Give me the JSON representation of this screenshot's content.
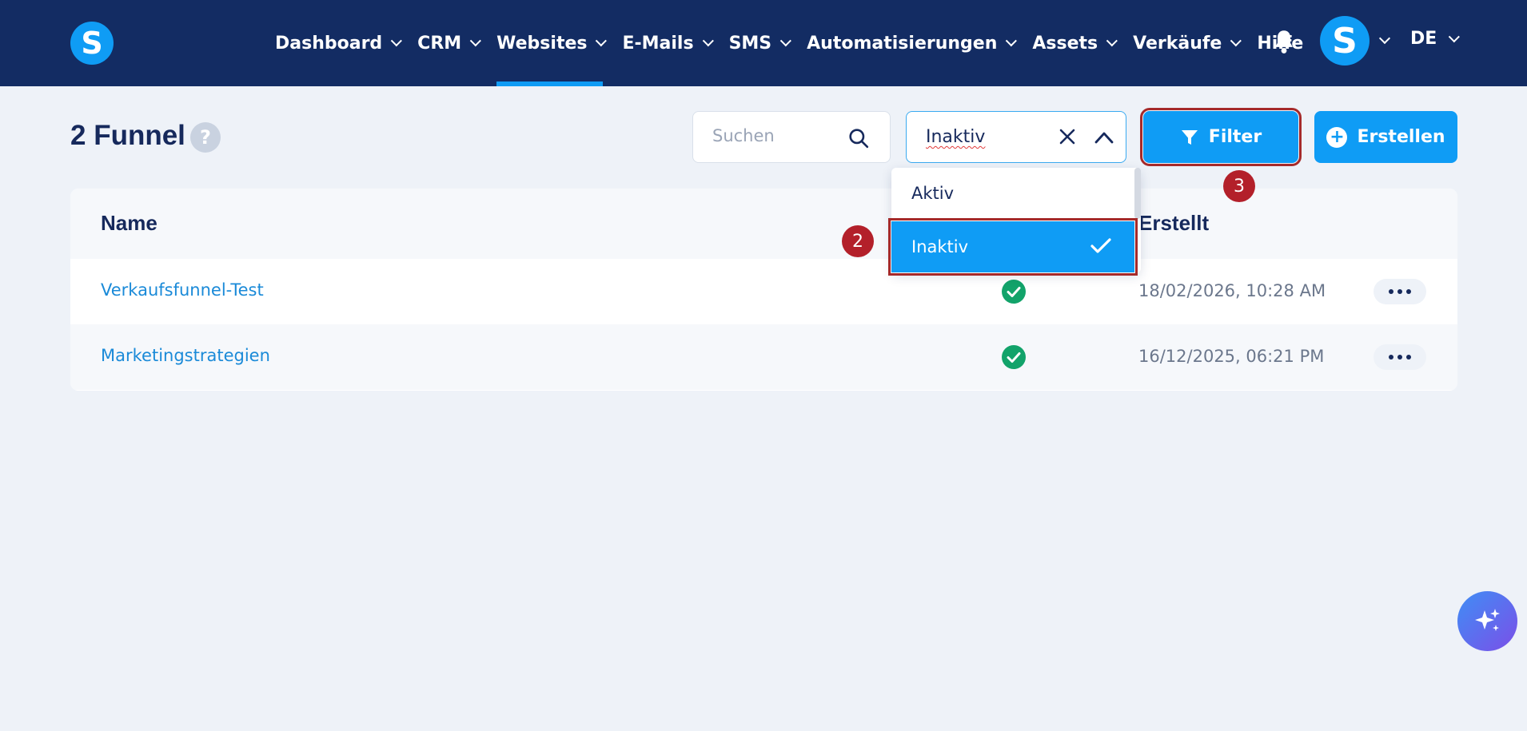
{
  "app": {
    "logo_letter": "S",
    "avatar_letter": "S",
    "language": "DE"
  },
  "nav": {
    "items": [
      {
        "label": "Dashboard"
      },
      {
        "label": "CRM"
      },
      {
        "label": "Websites"
      },
      {
        "label": "E-Mails"
      },
      {
        "label": "SMS"
      },
      {
        "label": "Automatisierungen"
      },
      {
        "label": "Assets"
      },
      {
        "label": "Verkäufe"
      },
      {
        "label": "Hilfe"
      }
    ],
    "active": "Websites"
  },
  "page": {
    "title": "2 Funnel",
    "help_symbol": "?"
  },
  "toolbar": {
    "search_placeholder": "Suchen",
    "status_select_value": "Inaktiv",
    "filter_label": "Filter",
    "create_label": "Erstellen"
  },
  "dropdown": {
    "options": [
      {
        "label": "Aktiv",
        "selected": false
      },
      {
        "label": "Inaktiv",
        "selected": true
      }
    ]
  },
  "table": {
    "columns": {
      "name": "Name",
      "created": "Erstellt"
    },
    "rows": [
      {
        "name": "Verkaufsfunnel-Test",
        "status": "active",
        "created": "18/02/2026, 10:28 AM"
      },
      {
        "name": "Marketingstrategien",
        "status": "active",
        "created": "16/12/2025, 06:21 PM"
      }
    ]
  },
  "badges": {
    "step2": "2",
    "step3": "3"
  },
  "colors": {
    "nav_bg": "#132c63",
    "accent": "#0f9cf5",
    "success": "#12a36a",
    "highlight": "#a52a2a"
  }
}
